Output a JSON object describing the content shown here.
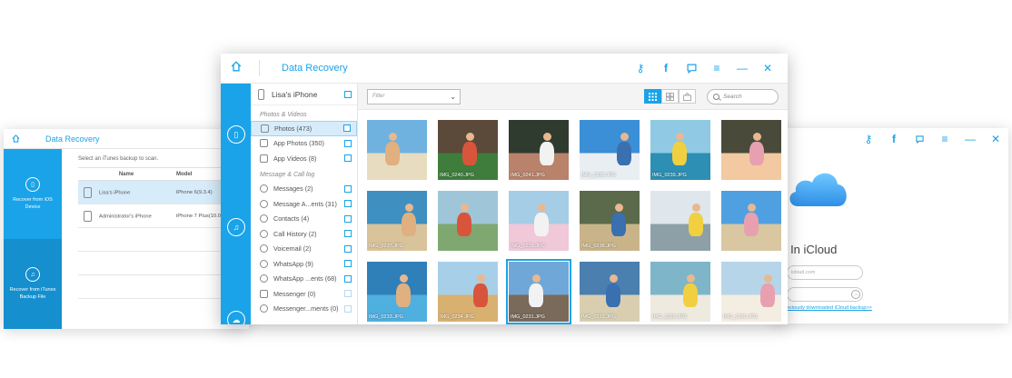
{
  "left_window": {
    "title": "Data Recovery",
    "hint": "Select an iTunes backup to scan.",
    "sidebar": [
      {
        "label": "Recover from iOS Device"
      },
      {
        "label": "Recover from iTunes Backup File"
      }
    ],
    "table": {
      "columns": [
        "Name",
        "Model"
      ],
      "rows": [
        {
          "name": "Lisa's iPhone",
          "model": "iPhone 6(9.3.4)"
        },
        {
          "name": "Administrator's iPhone",
          "model": "iPhone 7 Plus(10.0"
        }
      ]
    }
  },
  "right_window": {
    "heading": "gn In iCloud",
    "field1": "icloud.com",
    "link": "eviously downloaded iCloud backup>>"
  },
  "main_window": {
    "title": "Data Recovery",
    "device": "Lisa's iPhone",
    "categories": [
      {
        "label": "Photos & Videos",
        "items": [
          {
            "label": "Photos (473)",
            "active": true
          },
          {
            "label": "App Photos (350)"
          },
          {
            "label": "App Videos (8)"
          }
        ]
      },
      {
        "label": "Message & Call log",
        "items": [
          {
            "label": "Messages (2)"
          },
          {
            "label": "Message A...ents (31)"
          },
          {
            "label": "Contacts (4)"
          },
          {
            "label": "Call History (2)"
          },
          {
            "label": "Voicemail (2)"
          },
          {
            "label": "WhatsApp (9)"
          },
          {
            "label": "WhatsApp ...ents (68)"
          },
          {
            "label": "Messenger (0)"
          },
          {
            "label": "Messenger...ments (0)"
          }
        ]
      }
    ],
    "toolbar": {
      "filter_placeholder": "Filter",
      "search_placeholder": "Search"
    },
    "photos": [
      {
        "caption": "",
        "bg": "#6fb2e0",
        "ground": "#e8dcc0"
      },
      {
        "caption": "IMG_0240.JPG",
        "bg": "#5b4a3a",
        "ground": "#3f7d3c"
      },
      {
        "caption": "IMG_0241.JPG",
        "bg": "#2f3b2e",
        "ground": "#b9826a"
      },
      {
        "caption": "IMG_0238.JPG",
        "bg": "#3b8fd6",
        "ground": "#e9eef2"
      },
      {
        "caption": "IMG_0239.JPG",
        "bg": "#8fc9e4",
        "ground": "#2c8fb3"
      },
      {
        "caption": "",
        "bg": "#4a4a3a",
        "ground": "#f2c9a0"
      },
      {
        "caption": "IMG_0237.JPG",
        "bg": "#3f8fc0",
        "ground": "#d9c39a"
      },
      {
        "caption": "",
        "bg": "#9fc6d8",
        "ground": "#7ea870"
      },
      {
        "caption": "IMG_0235.JPG",
        "bg": "#a6cde6",
        "ground": "#f0c8d8"
      },
      {
        "caption": "IMG_0236.JPG",
        "bg": "#5a6a4a",
        "ground": "#c9b48a"
      },
      {
        "caption": "",
        "bg": "#dfe6ec",
        "ground": "#8da0a8"
      },
      {
        "caption": "",
        "bg": "#4fa0e0",
        "ground": "#d8c7a0"
      },
      {
        "caption": "IMG_0233.JPG",
        "bg": "#2f7fb8",
        "ground": "#4fb0e0"
      },
      {
        "caption": "IMG_0234.JPG",
        "bg": "#a8cfe8",
        "ground": "#d8b070"
      },
      {
        "caption": "IMG_0231.JPG",
        "bg": "#6fa8d8",
        "ground": "#7a6a5a",
        "selected": true
      },
      {
        "caption": "IMG_0232.JPG",
        "bg": "#4a7fb0",
        "ground": "#d9cfb0"
      },
      {
        "caption": "IMG_0229.JPG",
        "bg": "#7fb5c8",
        "ground": "#eeeae0"
      },
      {
        "caption": "IMG_0230.JPG",
        "bg": "#b7d5e8",
        "ground": "#f3ede2"
      }
    ]
  }
}
